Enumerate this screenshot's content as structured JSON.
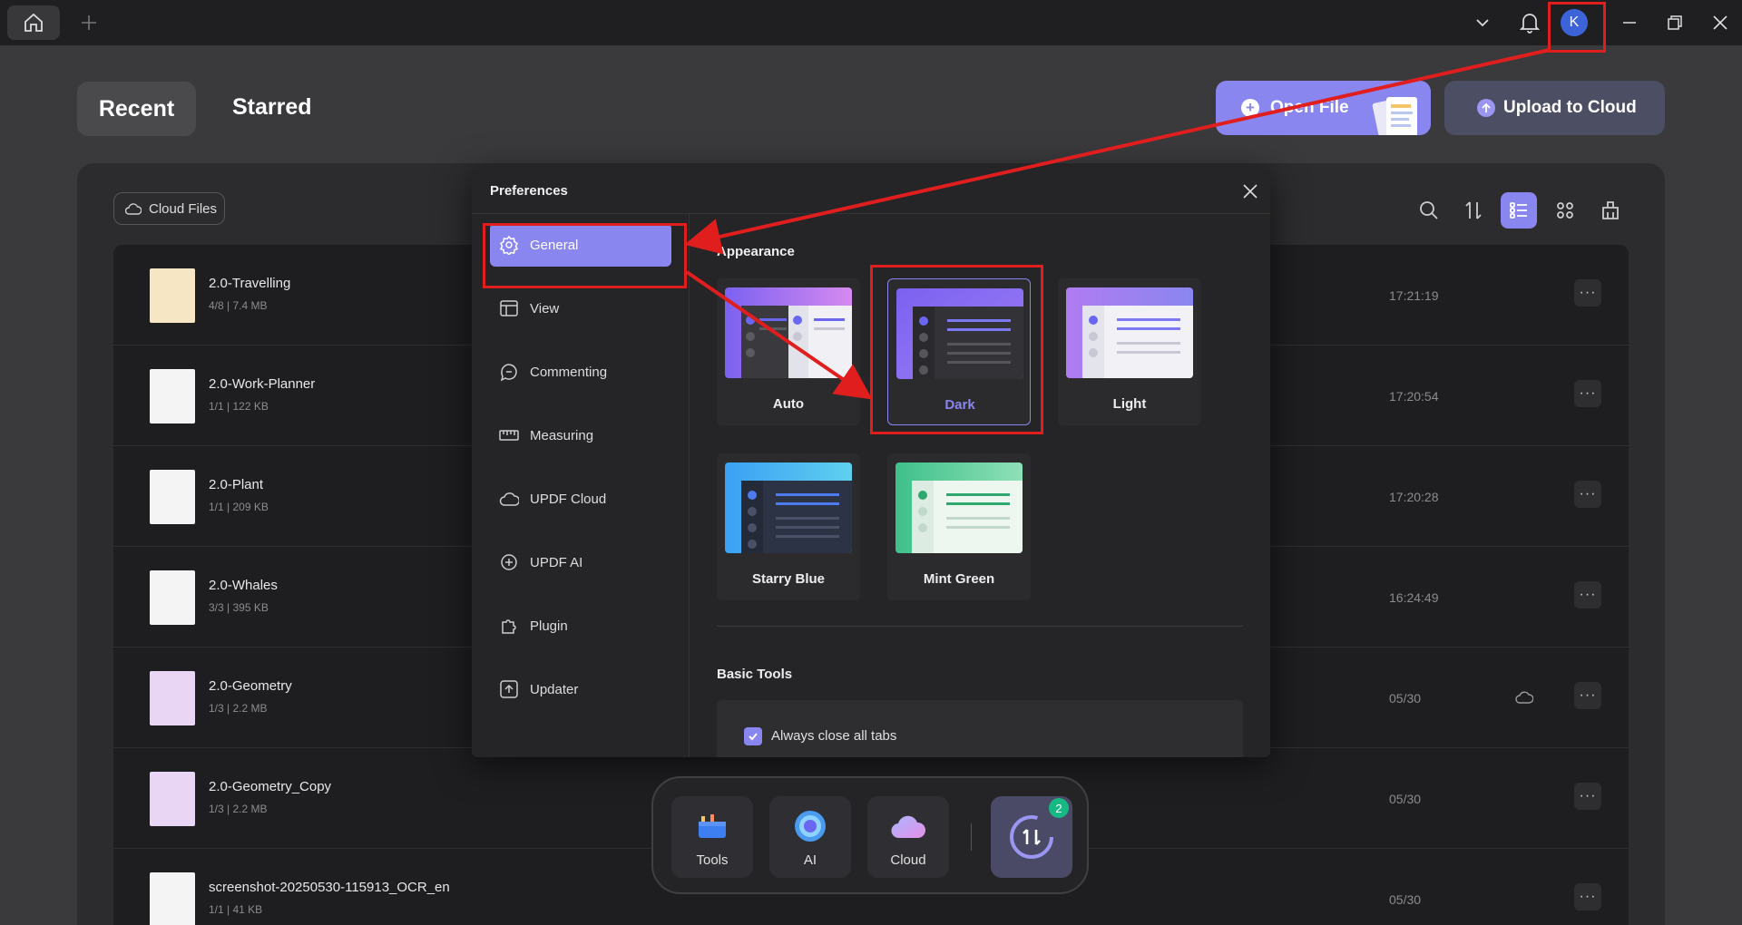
{
  "titlebar": {
    "home_icon": "home-icon",
    "add_tab_icon": "plus-icon",
    "avatar_letter": "K",
    "icons": [
      "chevron-down-icon",
      "bell-icon",
      "minimize-icon",
      "restore-icon",
      "close-icon"
    ]
  },
  "tabs": {
    "recent": "Recent",
    "starred": "Starred"
  },
  "actions": {
    "open_file": "Open File",
    "upload_to_cloud": "Upload to Cloud"
  },
  "panel": {
    "cloud_files": "Cloud Files",
    "tool_icons": [
      "search-icon",
      "sort-icon",
      "list-view-icon",
      "grid-view-icon",
      "clean-icon"
    ]
  },
  "files": [
    {
      "name": "2.0-Travelling",
      "meta": "4/8 | 7.4 MB",
      "time": "17:21:19",
      "cloud": false
    },
    {
      "name": "2.0-Work-Planner",
      "meta": "1/1 | 122 KB",
      "time": "17:20:54",
      "cloud": false
    },
    {
      "name": "2.0-Plant",
      "meta": "1/1 | 209 KB",
      "time": "17:20:28",
      "cloud": false
    },
    {
      "name": "2.0-Whales",
      "meta": "3/3 | 395 KB",
      "time": "16:24:49",
      "cloud": false
    },
    {
      "name": "2.0-Geometry",
      "meta": "1/3 | 2.2 MB",
      "time": "05/30",
      "cloud": true
    },
    {
      "name": "2.0-Geometry_Copy",
      "meta": "1/3 | 2.2 MB",
      "time": "05/30",
      "cloud": false
    },
    {
      "name": "screenshot-20250530-115913_OCR_en",
      "meta": "1/1 | 41 KB",
      "time": "05/30",
      "cloud": false
    }
  ],
  "more_label": "···",
  "preferences": {
    "title": "Preferences",
    "nav": [
      {
        "label": "General",
        "icon": "gear-icon",
        "active": true
      },
      {
        "label": "View",
        "icon": "view-icon",
        "active": false
      },
      {
        "label": "Commenting",
        "icon": "comment-icon",
        "active": false
      },
      {
        "label": "Measuring",
        "icon": "ruler-icon",
        "active": false
      },
      {
        "label": "UPDF Cloud",
        "icon": "cloud-icon",
        "active": false
      },
      {
        "label": "UPDF AI",
        "icon": "ai-icon",
        "active": false
      },
      {
        "label": "Plugin",
        "icon": "plugin-icon",
        "active": false
      },
      {
        "label": "Updater",
        "icon": "updater-icon",
        "active": false
      }
    ],
    "appearance_title": "Appearance",
    "themes": [
      {
        "name": "Auto",
        "selected": false
      },
      {
        "name": "Dark",
        "selected": true
      },
      {
        "name": "Light",
        "selected": false
      },
      {
        "name": "Starry Blue",
        "selected": false
      },
      {
        "name": "Mint Green",
        "selected": false
      }
    ],
    "basic_tools_title": "Basic Tools",
    "always_close_tabs": {
      "label": "Always close all tabs",
      "checked": true
    }
  },
  "dock": {
    "tools": "Tools",
    "ai": "AI",
    "cloud": "Cloud",
    "badge_count": "2"
  },
  "colors": {
    "accent": "#8a86ef",
    "annotation": "#e01e1e",
    "badge": "#18b884"
  }
}
